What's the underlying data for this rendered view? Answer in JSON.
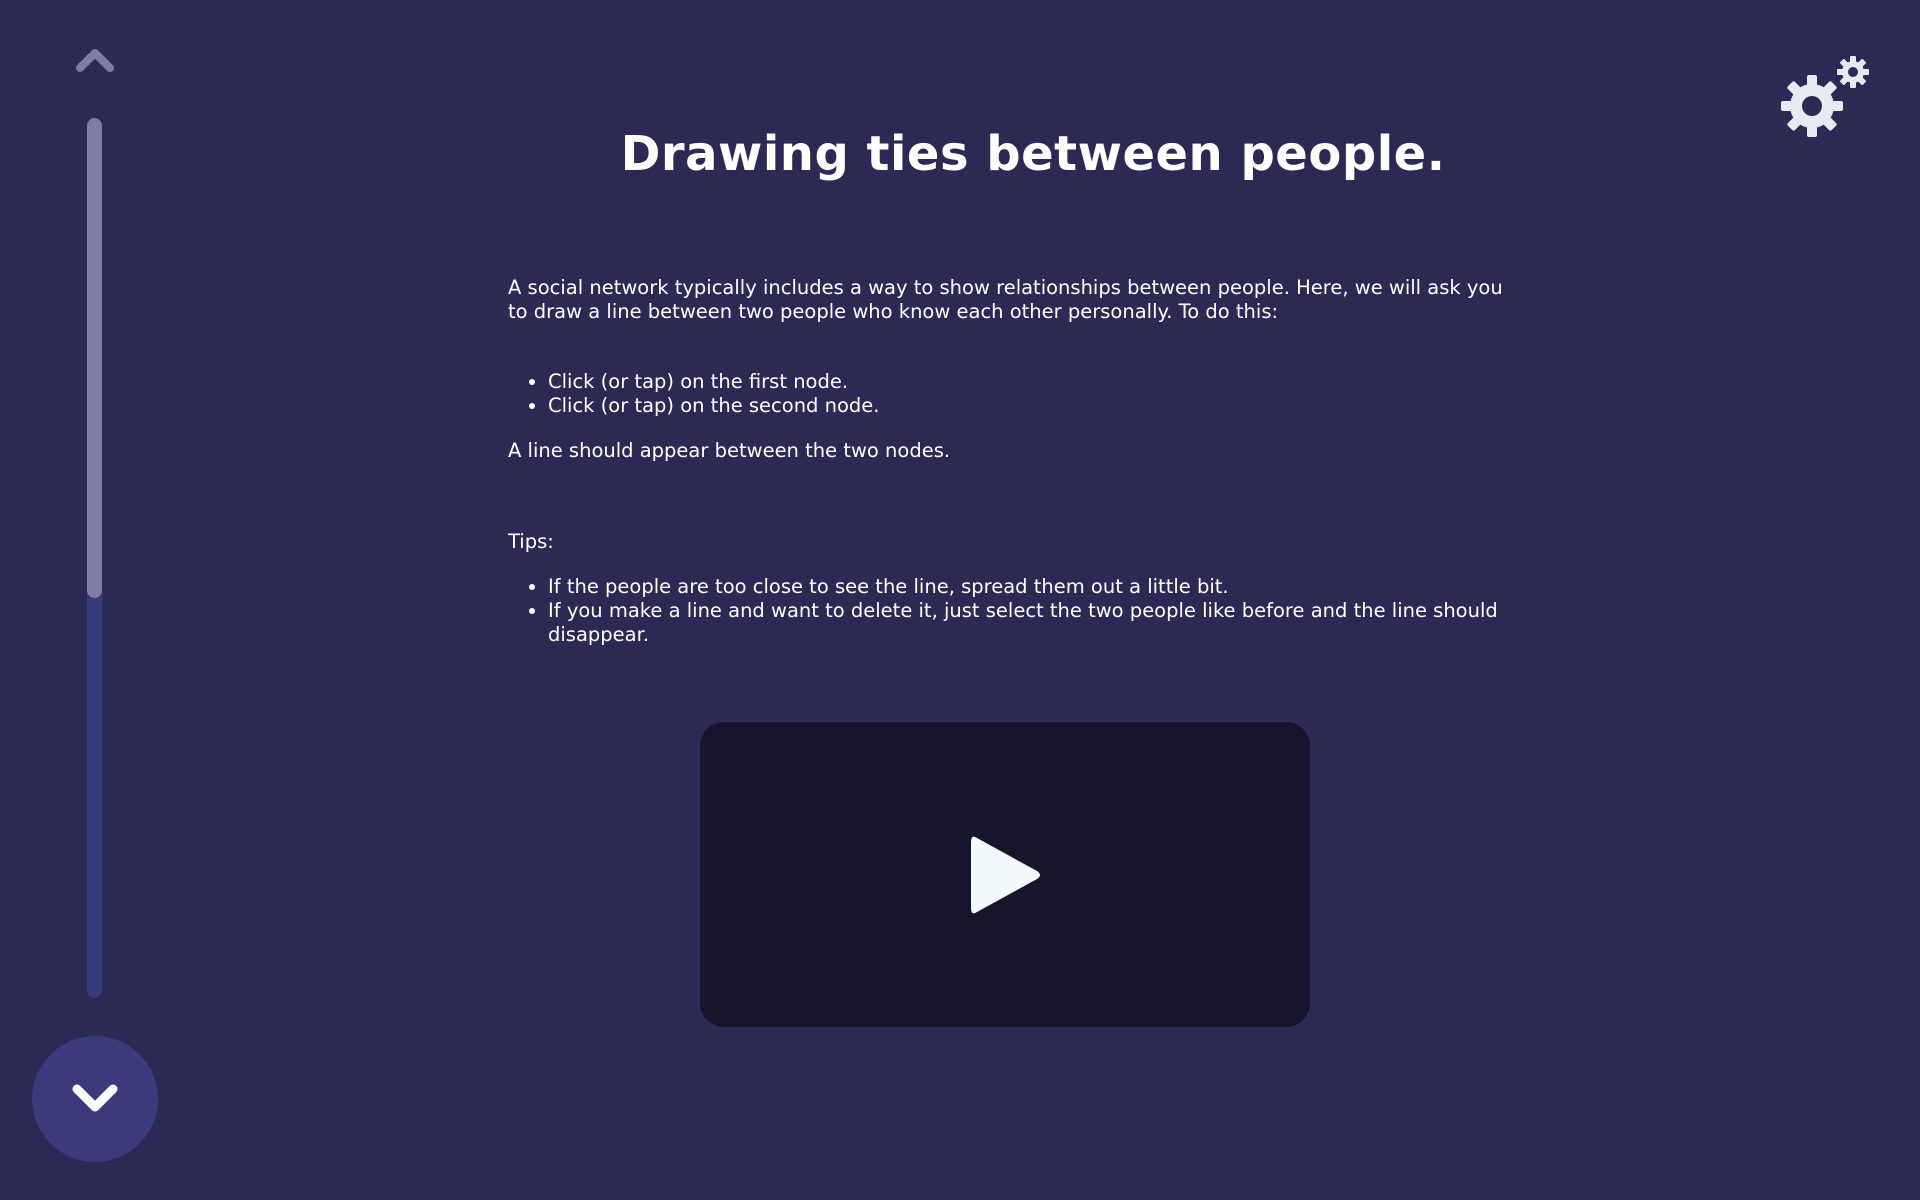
{
  "nav": {
    "up_icon": "chevron-up-icon",
    "down_icon": "chevron-down-icon",
    "progress": 0.545
  },
  "settings": {
    "icon": "gears-icon"
  },
  "main": {
    "title": "Drawing ties between people.",
    "intro": "A social network typically includes a way to show relationships between people. Here, we will ask you to draw a line between two people who know each other personally. To do this:",
    "steps": [
      "Click (or tap) on the first node.",
      "Click (or tap) on the second node."
    ],
    "result": "A line should appear between the two nodes.",
    "tips_label": "Tips:",
    "tips": [
      "If the people are too close to see the line, spread them out a little bit.",
      "If you make a line and want to delete it, just select the two people like before and the line should disappear."
    ]
  },
  "video": {
    "icon": "play-icon"
  },
  "colors": {
    "background": "#2d2955",
    "progress_track": "#3a3a78",
    "progress_fill": "#7f7ca6",
    "video_background": "#17142d",
    "text": "#ffffff"
  }
}
